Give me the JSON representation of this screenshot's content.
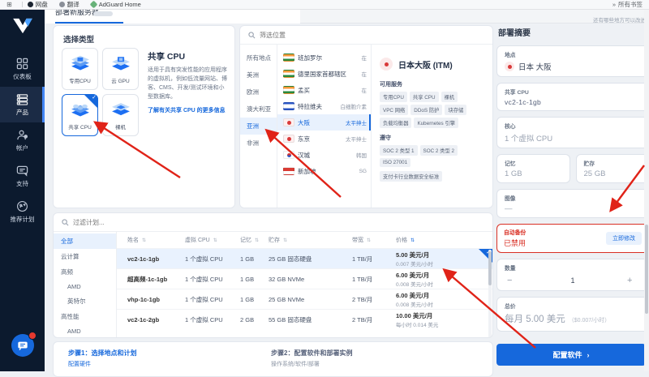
{
  "colors": {
    "accent": "#1668dc",
    "danger": "#d93025",
    "sidebar_bg": "#0c1a2e",
    "annotation": "#e02318"
  },
  "browser": {
    "bookmarks": [
      {
        "label": "网盘"
      },
      {
        "label": "翻译"
      },
      {
        "label": "AdGuard Home"
      }
    ],
    "more_label": "所有书签"
  },
  "tabbar": {
    "title": "部署新服务器",
    "feedback": "还有哪些地方可以改进"
  },
  "sidebar": {
    "items": [
      {
        "label": "仪表板"
      },
      {
        "label": "产品"
      },
      {
        "label": "帐户"
      },
      {
        "label": "支持"
      },
      {
        "label": "推荐计划"
      }
    ],
    "chat_badge": "1"
  },
  "type_panel": {
    "title": "选择类型",
    "cards": [
      {
        "label": "专用CPU"
      },
      {
        "label": "云 GPU"
      },
      {
        "label": "共享 CPU"
      },
      {
        "label": "裸机"
      }
    ],
    "info": {
      "title": "共享 CPU",
      "desc": "适用于具有突发性能的应用程序的虚拟机，例如低流量网站、博客、CMS、开发/测试环境和小型数据库。",
      "link": "了解有关共享 CPU 的更多信息"
    }
  },
  "locations": {
    "search_placeholder": "筛选位置",
    "regions": [
      {
        "label": "所有地点"
      },
      {
        "label": "美洲"
      },
      {
        "label": "欧洲"
      },
      {
        "label": "澳大利亚"
      },
      {
        "label": "亚洲"
      },
      {
        "label": "非洲"
      }
    ],
    "cities": [
      {
        "name": "班加罗尔",
        "tag": "在",
        "flag": "flag-india-icon"
      },
      {
        "name": "德里国家首都辖区",
        "tag": "在",
        "flag": "flag-india-icon"
      },
      {
        "name": "孟买",
        "tag": "在",
        "flag": "flag-india-icon"
      },
      {
        "name": "特拉维夫",
        "tag": "白细胞介素",
        "flag": "flag-israel-icon"
      },
      {
        "name": "大阪",
        "tag": "太平绅士",
        "flag": "flag-japan-icon"
      },
      {
        "name": "东京",
        "tag": "太平绅士",
        "flag": "flag-japan-icon"
      },
      {
        "name": "汉城",
        "tag": "韩国",
        "flag": "flag-korea-icon"
      },
      {
        "name": "新加坡",
        "tag": "SG",
        "flag": "flag-singapore-icon"
      }
    ],
    "detail": {
      "name": "日本大阪 (ITM)",
      "services_label": "可用服务",
      "services": [
        {
          "label": "专用CPU"
        },
        {
          "label": "共享 CPU"
        },
        {
          "label": "裸机"
        },
        {
          "label": "VPC 网络"
        },
        {
          "label": "DDoS 防护"
        },
        {
          "label": "块存储"
        },
        {
          "label": "负载均衡器"
        },
        {
          "label": "Kubernetes 引擎"
        }
      ],
      "compliance_label": "遵守",
      "compliance": [
        {
          "label": "SOC 2 类型 1"
        },
        {
          "label": "SOC 2 类型 2"
        },
        {
          "label": "ISO 27001"
        }
      ],
      "compliance_note": "支付卡行业数据安全标准"
    }
  },
  "plans": {
    "search_placeholder": "过滤计划...",
    "sort_icon": "⇅",
    "filters": [
      {
        "label": "全部"
      },
      {
        "label": "云计算"
      },
      {
        "label": "高频"
      },
      {
        "label": "AMD"
      },
      {
        "label": "英特尔"
      },
      {
        "label": "高性能"
      },
      {
        "label": "AMD"
      }
    ],
    "headers": {
      "name": "姓名",
      "cpu": "虚拟 CPU",
      "ram": "记忆",
      "storage": "贮存",
      "bandwidth": "带宽",
      "price": "价格"
    },
    "rows": [
      {
        "name": "vc2-1c-1gb",
        "cpu": "1 个虚拟 CPU",
        "ram": "1 GB",
        "storage": "25 GB 固态硬盘",
        "bandwidth": "1 TB/月",
        "price": "5.00 美元/月",
        "price_sub": "0.007 美元/小时"
      },
      {
        "name": "超高频-1c-1gb",
        "cpu": "1 个虚拟 CPU",
        "ram": "1 GB",
        "storage": "32 GB NVMe",
        "bandwidth": "1 TB/月",
        "price": "6.00 美元/月",
        "price_sub": "0.008 美元/小时"
      },
      {
        "name": "vhp-1c-1gb",
        "cpu": "1 个虚拟 CPU",
        "ram": "1 GB",
        "storage": "25 GB NVMe",
        "bandwidth": "2 TB/月",
        "price": "6.00 美元/月",
        "price_sub": "0.008 美元/小时"
      },
      {
        "name": "vc2-1c-2gb",
        "cpu": "1 个虚拟 CPU",
        "ram": "2 GB",
        "storage": "55 GB 固态硬盘",
        "bandwidth": "2 TB/月",
        "price": "10.00 美元/月",
        "price_sub": "每小时 0.014 美元"
      }
    ]
  },
  "steps": {
    "step1_title": "步骤1：选择地点和计划",
    "step1_sub": "配置硬件",
    "step2_title": "步骤2：配置软件和部署实例",
    "step2_sub": "操作系统/软件/部署"
  },
  "summary": {
    "title": "部署摘要",
    "location_label": "地点",
    "location": "日本 大阪",
    "cpu_label": "共享 CPU",
    "cpu": "vc2-1c-1gb",
    "core_label": "核心",
    "core": "1 个虚拟 CPU",
    "ram_label": "记忆",
    "ram": "1 GB",
    "storage_label": "贮存",
    "storage": "25 GB",
    "image_label": "图像",
    "image": "—",
    "backup_label": "自动备份",
    "backup_status": "已禁用",
    "backup_button": "立即修改",
    "qty_label": "数量",
    "qty_minus": "−",
    "qty": "1",
    "qty_plus": "+",
    "total_label": "总价",
    "total": "每月 5.00 美元",
    "total_hint": "（$0.007/小时）",
    "deploy_button": "配置软件",
    "deploy_chevron": "›"
  }
}
